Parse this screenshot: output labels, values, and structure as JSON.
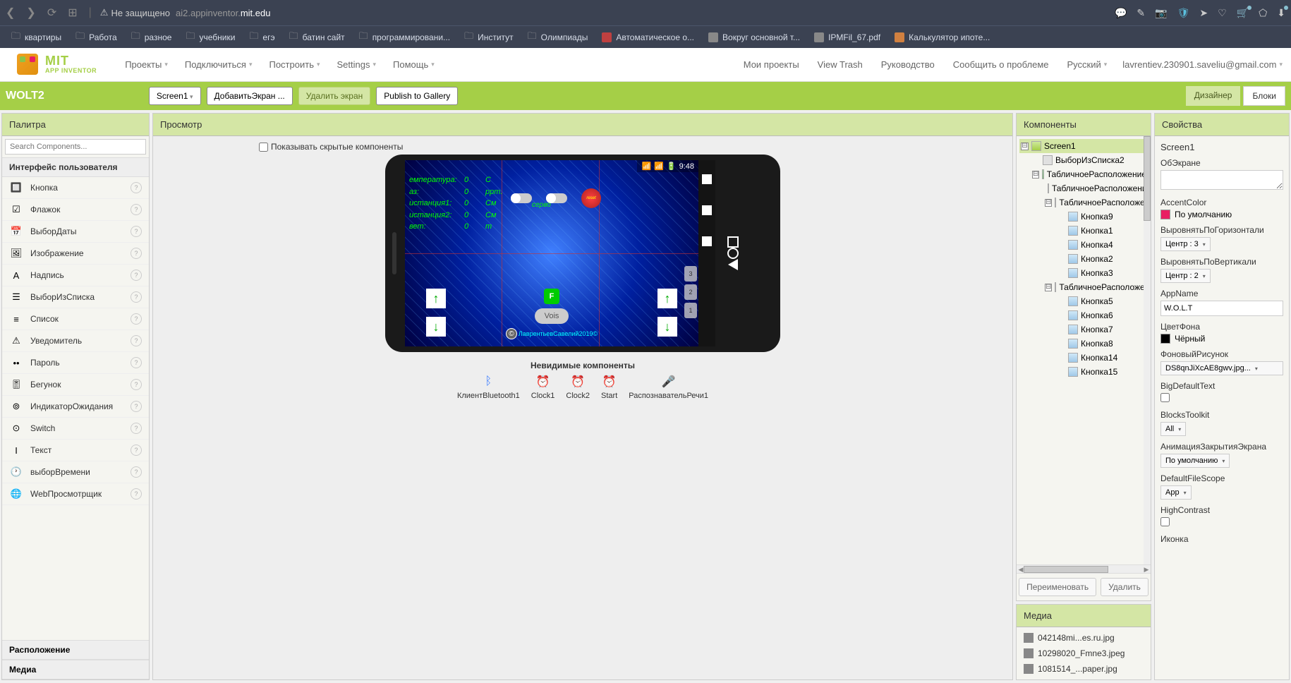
{
  "browser": {
    "security_label": "Не защищено",
    "url_host": "ai2.appinventor.",
    "url_domain": "mit.edu"
  },
  "bookmarks": [
    {
      "label": "квартиры",
      "type": "folder"
    },
    {
      "label": "Работа",
      "type": "folder"
    },
    {
      "label": "разное",
      "type": "folder"
    },
    {
      "label": "учебники",
      "type": "folder"
    },
    {
      "label": "егэ",
      "type": "folder"
    },
    {
      "label": "батин сайт",
      "type": "folder"
    },
    {
      "label": "программировани...",
      "type": "folder"
    },
    {
      "label": "Институт",
      "type": "folder"
    },
    {
      "label": "Олимпиады",
      "type": "folder"
    },
    {
      "label": "Автоматическое о...",
      "type": "icon-red"
    },
    {
      "label": "Вокруг основной т...",
      "type": "icon-grey"
    },
    {
      "label": "IPMFil_67.pdf",
      "type": "icon-grey"
    },
    {
      "label": "Калькулятор ипоте...",
      "type": "icon-orange"
    }
  ],
  "logo": {
    "mit": "MIT",
    "sub": "APP INVENTOR"
  },
  "menu": [
    "Проекты",
    "Подключиться",
    "Построить",
    "Settings",
    "Помощь"
  ],
  "header_right": {
    "my_projects": "Мои проекты",
    "view_trash": "View Trash",
    "guide": "Руководство",
    "report": "Сообщить о проблеме",
    "lang": "Русский",
    "email": "lavrentiev.230901.saveliu@gmail.com"
  },
  "toolbar": {
    "project": "WOLT2",
    "screen": "Screen1",
    "add_screen": "ДобавитьЭкран ...",
    "delete_screen": "Удалить экран",
    "publish": "Publish to Gallery",
    "designer": "Дизайнер",
    "blocks": "Блоки"
  },
  "palette": {
    "title": "Палитра",
    "search_placeholder": "Search Components...",
    "section_ui": "Интерфейс пользователя",
    "section_layout": "Расположение",
    "section_media": "Медиа",
    "items": [
      {
        "label": "Кнопка",
        "icon": "🔲"
      },
      {
        "label": "Флажок",
        "icon": "☑"
      },
      {
        "label": "ВыборДаты",
        "icon": "📅"
      },
      {
        "label": "Изображение",
        "icon": "🖼"
      },
      {
        "label": "Надпись",
        "icon": "A"
      },
      {
        "label": "ВыборИзСписка",
        "icon": "☰"
      },
      {
        "label": "Список",
        "icon": "≡"
      },
      {
        "label": "Уведомитель",
        "icon": "⚠"
      },
      {
        "label": "Пароль",
        "icon": "••"
      },
      {
        "label": "Бегунок",
        "icon": "🎚"
      },
      {
        "label": "ИндикаторОжидания",
        "icon": "⊚"
      },
      {
        "label": "Switch",
        "icon": "⊙"
      },
      {
        "label": "Текст",
        "icon": "I"
      },
      {
        "label": "выборВремени",
        "icon": "🕐"
      },
      {
        "label": "WebПросмотрщик",
        "icon": "🌐"
      }
    ]
  },
  "viewer": {
    "title": "Просмотр",
    "show_hidden": "Показывать скрытые компоненты",
    "time": "9:48",
    "sensors": [
      [
        "емпература:",
        "0",
        "С"
      ],
      [
        "аз:",
        "0",
        "ppm."
      ],
      [
        "истанция1:",
        "0",
        "См"
      ],
      [
        "истанция2:",
        "0",
        "См"
      ],
      [
        "вет:",
        "0",
        "m"
      ]
    ],
    "reset": "reset",
    "servo": "серво",
    "f_btn": "F",
    "vois": "Vois",
    "copyright": "ЛаврентьевСавелий2019©",
    "side_nums": [
      "3",
      "2",
      "1"
    ],
    "invisible_title": "Невидимые компоненты",
    "invisible": [
      {
        "label": "КлиентBluetooth1",
        "icon": "ᛒ",
        "color": "#4080ff"
      },
      {
        "label": "Clock1",
        "icon": "⏰",
        "color": "#c0a080"
      },
      {
        "label": "Clock2",
        "icon": "⏰",
        "color": "#c0a080"
      },
      {
        "label": "Start",
        "icon": "⏰",
        "color": "#c0a080"
      },
      {
        "label": "РаспознавательРечи1",
        "icon": "🎤",
        "color": "#80c040"
      }
    ]
  },
  "components": {
    "title": "Компоненты",
    "rename": "Переименовать",
    "delete": "Удалить",
    "tree": [
      {
        "label": "Screen1",
        "indent": 0,
        "expand": "-",
        "icon": "screen",
        "selected": true
      },
      {
        "label": "ВыборИзСписка2",
        "indent": 1,
        "expand": "",
        "icon": "list"
      },
      {
        "label": "ТабличноеРасположение",
        "indent": 1,
        "expand": "-",
        "icon": "table"
      },
      {
        "label": "ТабличноеРасположение",
        "indent": 2,
        "expand": "",
        "icon": "table"
      },
      {
        "label": "ТабличноеРасположение",
        "indent": 2,
        "expand": "-",
        "icon": "table"
      },
      {
        "label": "Кнопка9",
        "indent": 3,
        "expand": "",
        "icon": "btn"
      },
      {
        "label": "Кнопка1",
        "indent": 3,
        "expand": "",
        "icon": "btn"
      },
      {
        "label": "Кнопка4",
        "indent": 3,
        "expand": "",
        "icon": "btn"
      },
      {
        "label": "Кнопка2",
        "indent": 3,
        "expand": "",
        "icon": "btn"
      },
      {
        "label": "Кнопка3",
        "indent": 3,
        "expand": "",
        "icon": "btn"
      },
      {
        "label": "ТабличноеРасположение",
        "indent": 2,
        "expand": "-",
        "icon": "table"
      },
      {
        "label": "Кнопка5",
        "indent": 3,
        "expand": "",
        "icon": "btn"
      },
      {
        "label": "Кнопка6",
        "indent": 3,
        "expand": "",
        "icon": "btn"
      },
      {
        "label": "Кнопка7",
        "indent": 3,
        "expand": "",
        "icon": "btn"
      },
      {
        "label": "Кнопка8",
        "indent": 3,
        "expand": "",
        "icon": "btn"
      },
      {
        "label": "Кнопка14",
        "indent": 3,
        "expand": "",
        "icon": "btn"
      },
      {
        "label": "Кнопка15",
        "indent": 3,
        "expand": "",
        "icon": "btn"
      }
    ]
  },
  "media": {
    "title": "Медиа",
    "items": [
      "042148mi...es.ru.jpg",
      "10298020_Fmne3.jpeg",
      "1081514_...paper.jpg"
    ]
  },
  "properties": {
    "title": "Свойства",
    "component": "Screen1",
    "about_label": "ОбЭкране",
    "accent_label": "AccentColor",
    "accent_value": "По умолчанию",
    "accent_color": "#e91e63",
    "halign_label": "ВыровнятьПоГоризонтали",
    "halign_value": "Центр : 3",
    "valign_label": "ВыровнятьПоВертикали",
    "valign_value": "Центр : 2",
    "appname_label": "AppName",
    "appname_value": "W.O.L.T",
    "bgcolor_label": "ЦветФона",
    "bgcolor_value": "Чёрный",
    "bgcolor_color": "#000000",
    "bgimage_label": "ФоновыйРисунок",
    "bgimage_value": "DS8qnJiXcAE8gwv.jpg...",
    "bigdefault_label": "BigDefaultText",
    "blocks_label": "BlocksToolkit",
    "blocks_value": "All",
    "closeanim_label": "АнимацияЗакрытияЭкрана",
    "closeanim_value": "По умолчанию",
    "filescope_label": "DefaultFileScope",
    "filescope_value": "App",
    "highcontrast_label": "HighContrast",
    "icon_label": "Иконка"
  }
}
